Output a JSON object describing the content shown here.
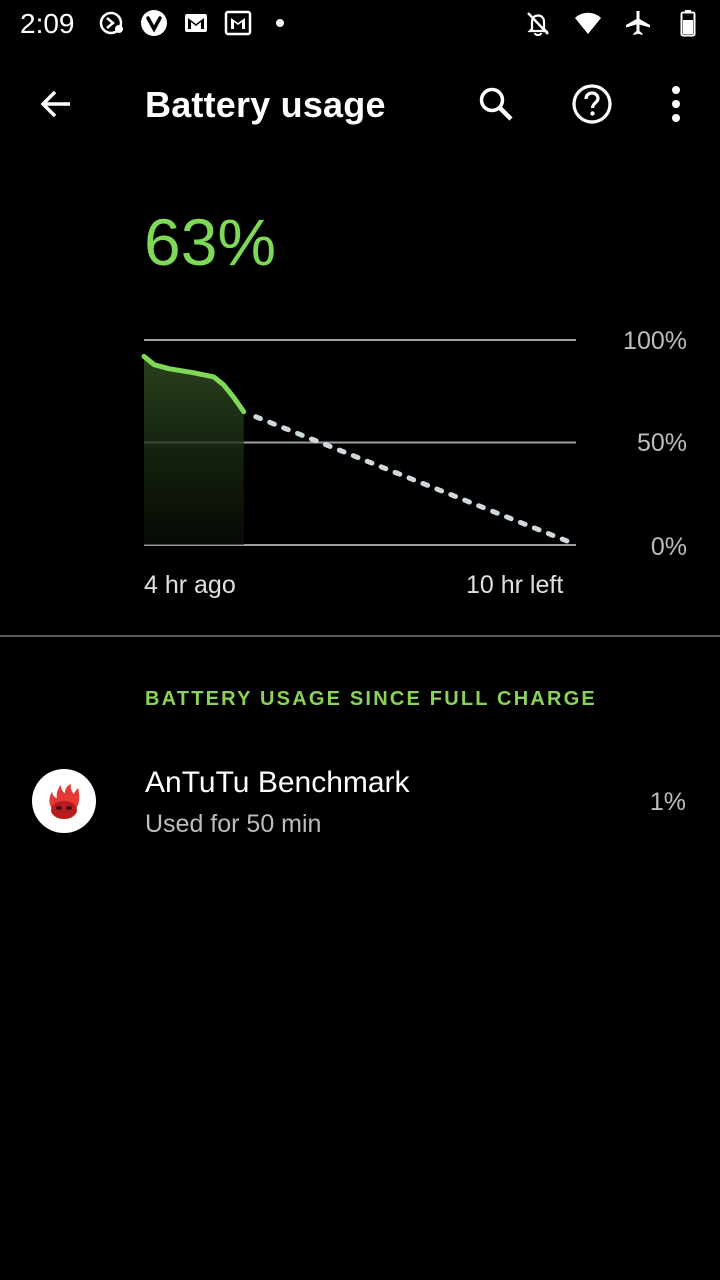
{
  "status_bar": {
    "time": "2:09",
    "left_icons": [
      "clock-hand-icon",
      "vivaldi-icon",
      "gmail-icon",
      "gmail-icon",
      "dot-icon"
    ],
    "right_icons": [
      "notifications-off-icon",
      "wifi-icon",
      "airplane-icon",
      "battery-icon"
    ]
  },
  "app_bar": {
    "title": "Battery usage",
    "actions": [
      "search-icon",
      "help-icon",
      "more-vert-icon"
    ]
  },
  "battery": {
    "percent": "63%"
  },
  "chart_data": {
    "type": "line",
    "y_tick_labels": [
      "100%",
      "50%",
      "0%"
    ],
    "ylim": [
      0,
      100
    ],
    "x_tick_labels": [
      "4 hr ago",
      "10 hr left"
    ],
    "series": [
      {
        "kind": "history",
        "x": [
          0,
          0.1,
          0.25,
          0.5,
          0.7,
          0.8,
          0.9,
          1.0
        ],
        "y": [
          92,
          88,
          86,
          84,
          82,
          78,
          72,
          65
        ]
      },
      {
        "kind": "prediction",
        "x": [
          1.0,
          4.33
        ],
        "y": [
          65,
          0
        ]
      }
    ],
    "colors": {
      "line": "#7ed957",
      "fill_top": "#2f4a22",
      "grid": "#9e9e9e",
      "prediction": "#cfd8dc"
    }
  },
  "section": {
    "header": "BATTERY USAGE SINCE FULL CHARGE"
  },
  "apps": [
    {
      "name": "AnTuTu Benchmark",
      "usage": "Used for 50 min",
      "percent": "1%",
      "icon": "antutu-icon"
    }
  ]
}
